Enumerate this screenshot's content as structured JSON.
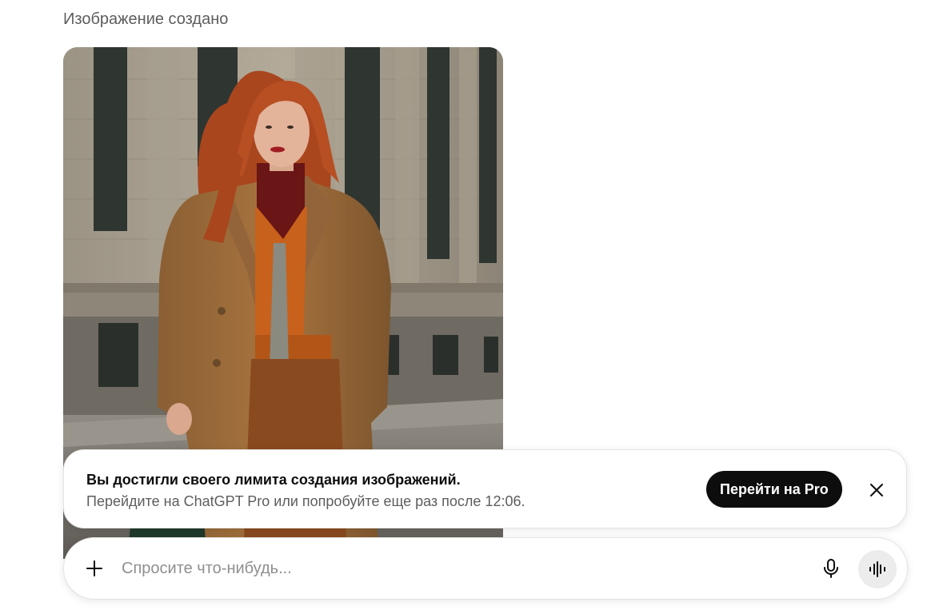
{
  "status": {
    "text": "Изображение создано"
  },
  "image": {
    "description_icon": "generated-image"
  },
  "limit_banner": {
    "title": "Вы достигли своего лимита создания изображений.",
    "subtitle": "Перейдите на ChatGPT Pro или попробуйте еще раз после 12:06.",
    "upgrade_label": "Перейти на Pro",
    "close_icon": "close-icon"
  },
  "composer": {
    "placeholder": "Спросите что-нибудь...",
    "value": "",
    "plus_icon": "plus-icon",
    "mic_icon": "microphone-icon",
    "voice_icon": "voice-mode-icon"
  },
  "colors": {
    "button_bg": "#0d0d0d",
    "button_text": "#ffffff",
    "voice_bg": "#ececec",
    "muted_text": "#5d5d5d"
  }
}
